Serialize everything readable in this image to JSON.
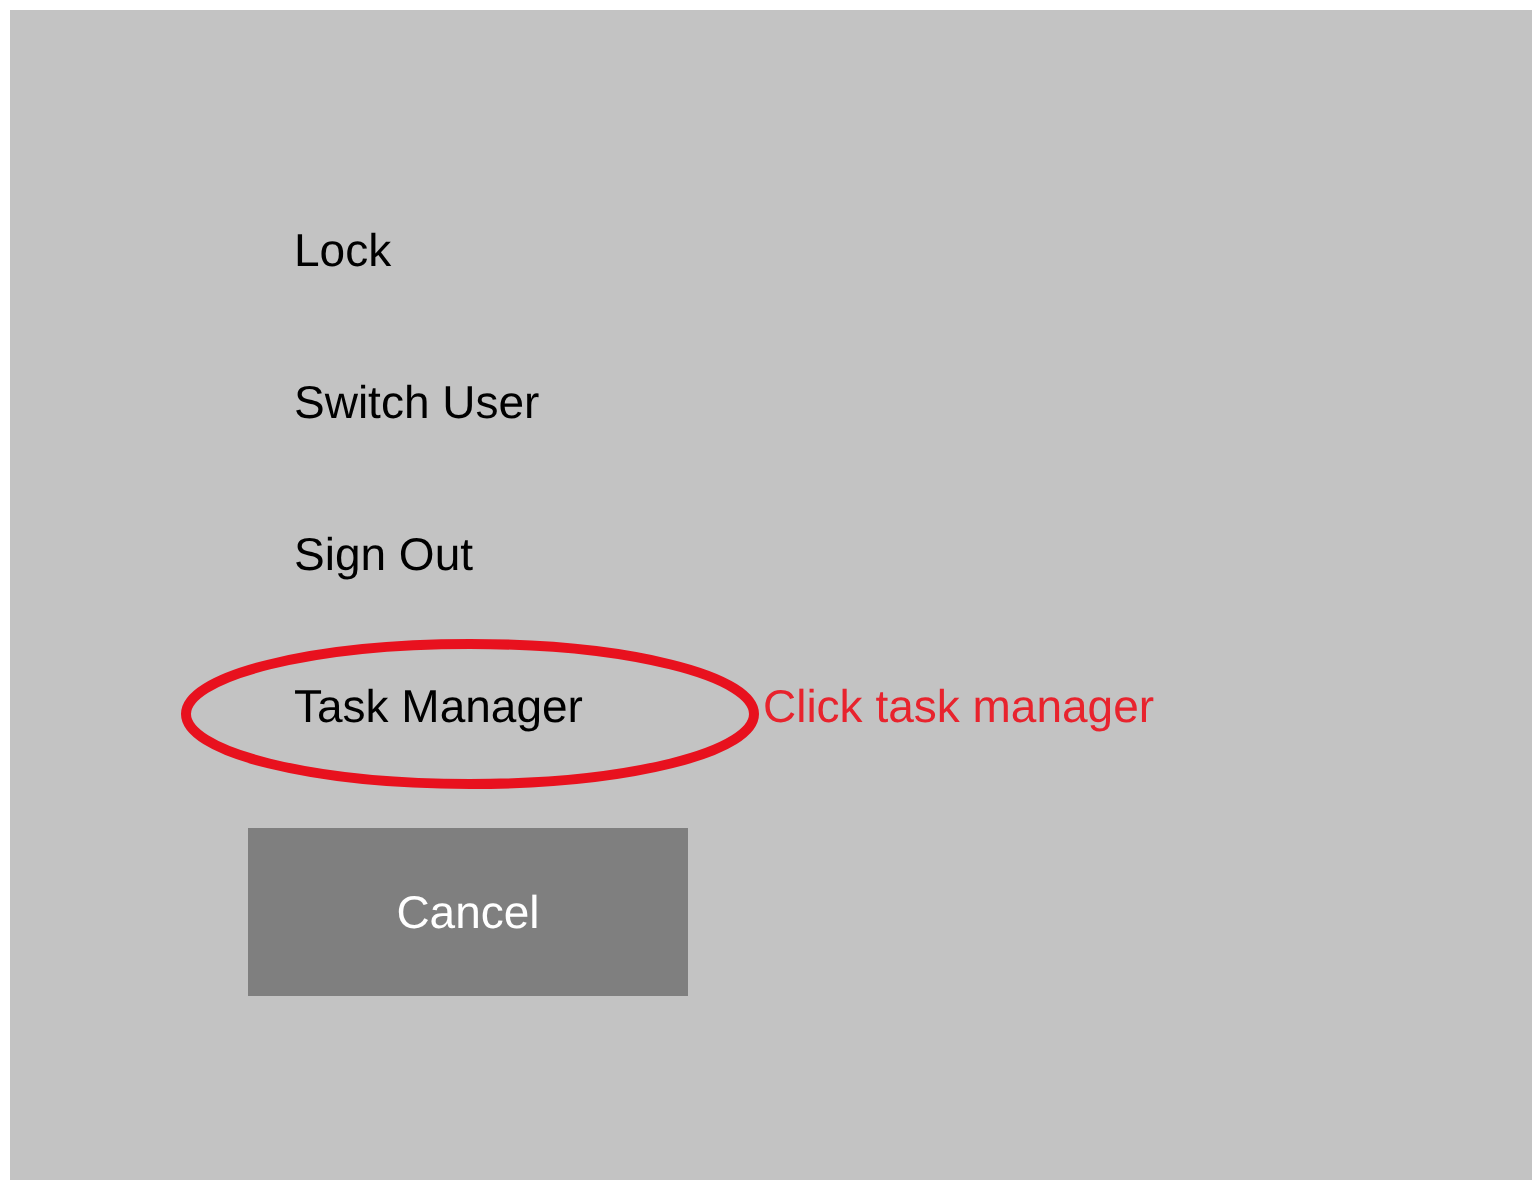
{
  "menu": {
    "items": [
      {
        "label": "Lock",
        "circled": false
      },
      {
        "label": "Switch User",
        "circled": false
      },
      {
        "label": "Sign Out",
        "circled": false
      },
      {
        "label": "Task Manager",
        "circled": true
      }
    ]
  },
  "cancel_button": {
    "label": "Cancel"
  },
  "annotation": {
    "text": "Click task manager"
  }
}
